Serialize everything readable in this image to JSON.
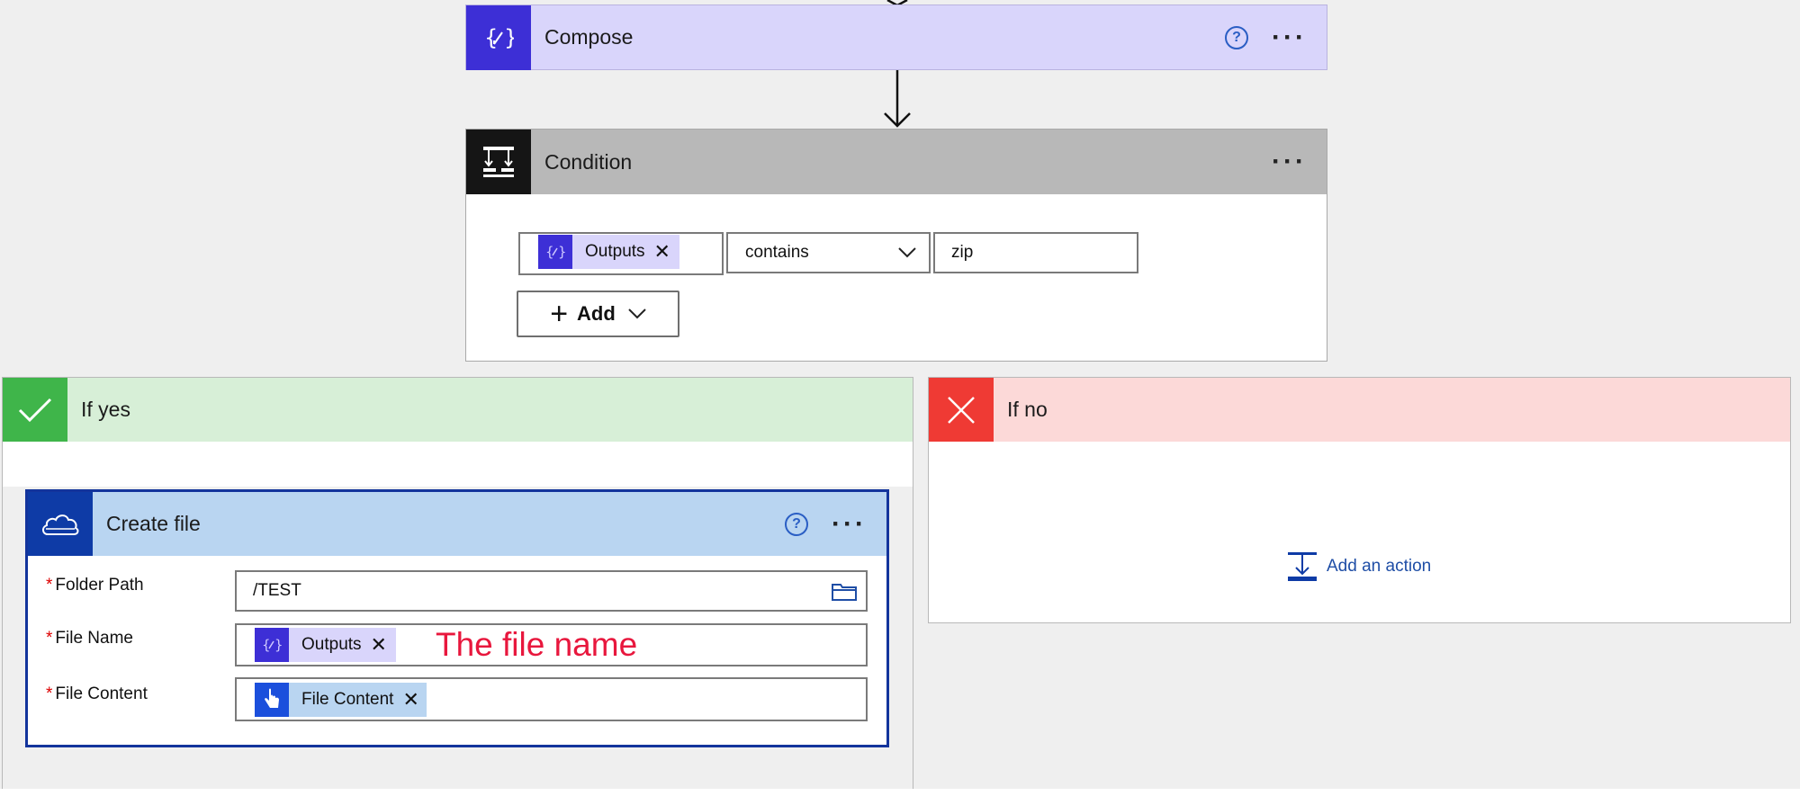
{
  "compose": {
    "title": "Compose",
    "help": "?",
    "more": "···"
  },
  "condition": {
    "title": "Condition",
    "more": "···",
    "left_token": "Outputs",
    "token_remove": "✕",
    "operator": "contains",
    "value": "zip",
    "add_label": "Add"
  },
  "if_yes": {
    "title": "If yes"
  },
  "if_no": {
    "title": "If no",
    "add_action": "Add an action"
  },
  "create_file": {
    "title": "Create file",
    "help": "?",
    "more": "···",
    "required_mark": "*",
    "folder_path_label": "Folder Path",
    "folder_path_value": "/TEST",
    "file_name_label": "File Name",
    "file_name_token": "Outputs",
    "file_name_annotation": "The file name",
    "file_content_label": "File Content",
    "file_content_token": "File Content",
    "token_remove": "✕"
  },
  "colors": {
    "compose_accent": "#3d2fd6",
    "condition_accent": "#151515",
    "yes_accent": "#3fb54a",
    "no_accent": "#ef3a34",
    "onedrive_accent": "#0e3ba6",
    "annotation": "#e8173d"
  },
  "icons": {
    "compose": "curly-braces-pen-icon",
    "condition": "condition-branch-icon",
    "yes": "checkmark-icon",
    "no": "close-icon",
    "create_file": "onedrive-cloud-icon",
    "folder": "folder-icon",
    "file_content": "manual-trigger-hand-icon",
    "add_action": "add-action-icon"
  }
}
